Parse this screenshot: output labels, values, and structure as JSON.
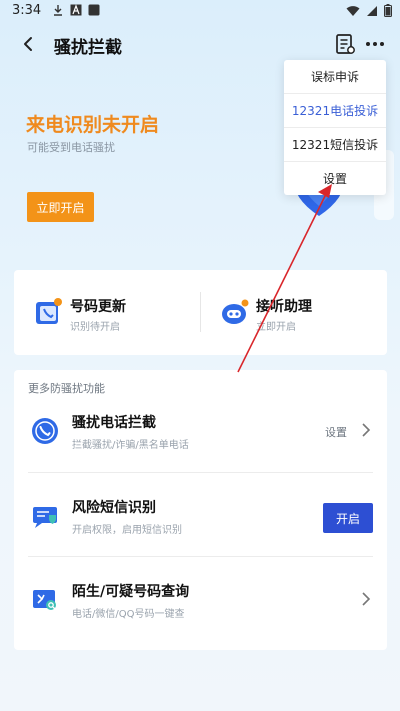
{
  "status_bar": {
    "time": "3:34",
    "left_icons": [
      "download-icon",
      "font-a-icon",
      "square-icon"
    ],
    "right_icons": [
      "wifi-icon",
      "signal-icon",
      "battery-icon"
    ]
  },
  "header": {
    "title": "骚扰拦截",
    "back_icon": "back-arrow-icon",
    "doc_icon": "document-list-icon",
    "more_icon": "more-dots-icon"
  },
  "hero": {
    "title": "来电识别未开启",
    "subtitle": "可能受到电话骚扰",
    "button_label": "立即开启",
    "accent": "#ef8a1f"
  },
  "menu": {
    "items": [
      {
        "label": "误标申诉",
        "active": false
      },
      {
        "label": "12321电话投诉",
        "active": true
      },
      {
        "label": "12321短信投诉",
        "active": false
      },
      {
        "label": "设置",
        "active": false
      }
    ]
  },
  "quick_cards": [
    {
      "title": "号码更新",
      "subtitle": "识别待开启",
      "icon": "phone-book-icon"
    },
    {
      "title": "接听助理",
      "subtitle": "立即开启",
      "icon": "robot-assistant-icon"
    }
  ],
  "features": {
    "section_title": "更多防骚扰功能",
    "items": [
      {
        "title": "骚扰电话拦截",
        "subtitle": "拦截骚扰/诈骗/黑名单电话",
        "right_text": "设置",
        "icon": "phone-block-icon"
      },
      {
        "title": "风险短信识别",
        "subtitle": "开启权限，启用短信识别",
        "button_label": "开启",
        "icon": "sms-shield-icon"
      },
      {
        "title": "陌生/可疑号码查询",
        "subtitle": "电话/微信/QQ号码一键查",
        "icon": "number-search-icon"
      }
    ]
  },
  "colors": {
    "primary_blue": "#2d4fd3",
    "orange": "#f39318",
    "annotation_red": "#d9262b"
  }
}
